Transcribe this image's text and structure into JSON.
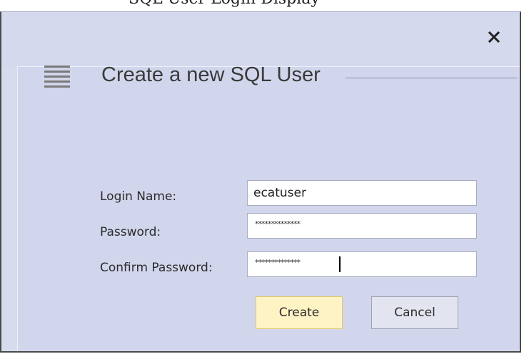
{
  "top_strip": {
    "text": "SQL User Login Display"
  },
  "dialog": {
    "close_glyph": "✕",
    "header": {
      "icon": "lines-icon",
      "title": "Create a new SQL User"
    },
    "fields": [
      {
        "label": "Login Name:",
        "value": "ecatuser"
      },
      {
        "label": "Password:",
        "value": "**************"
      },
      {
        "label": "Confirm Password:",
        "value": "**************"
      }
    ],
    "buttons": {
      "create": "Create",
      "cancel": "Cancel"
    }
  },
  "colors": {
    "dialog_bg": "#d7dbee",
    "create_bg": "#fdf3c4",
    "create_border": "#e0c86a"
  }
}
